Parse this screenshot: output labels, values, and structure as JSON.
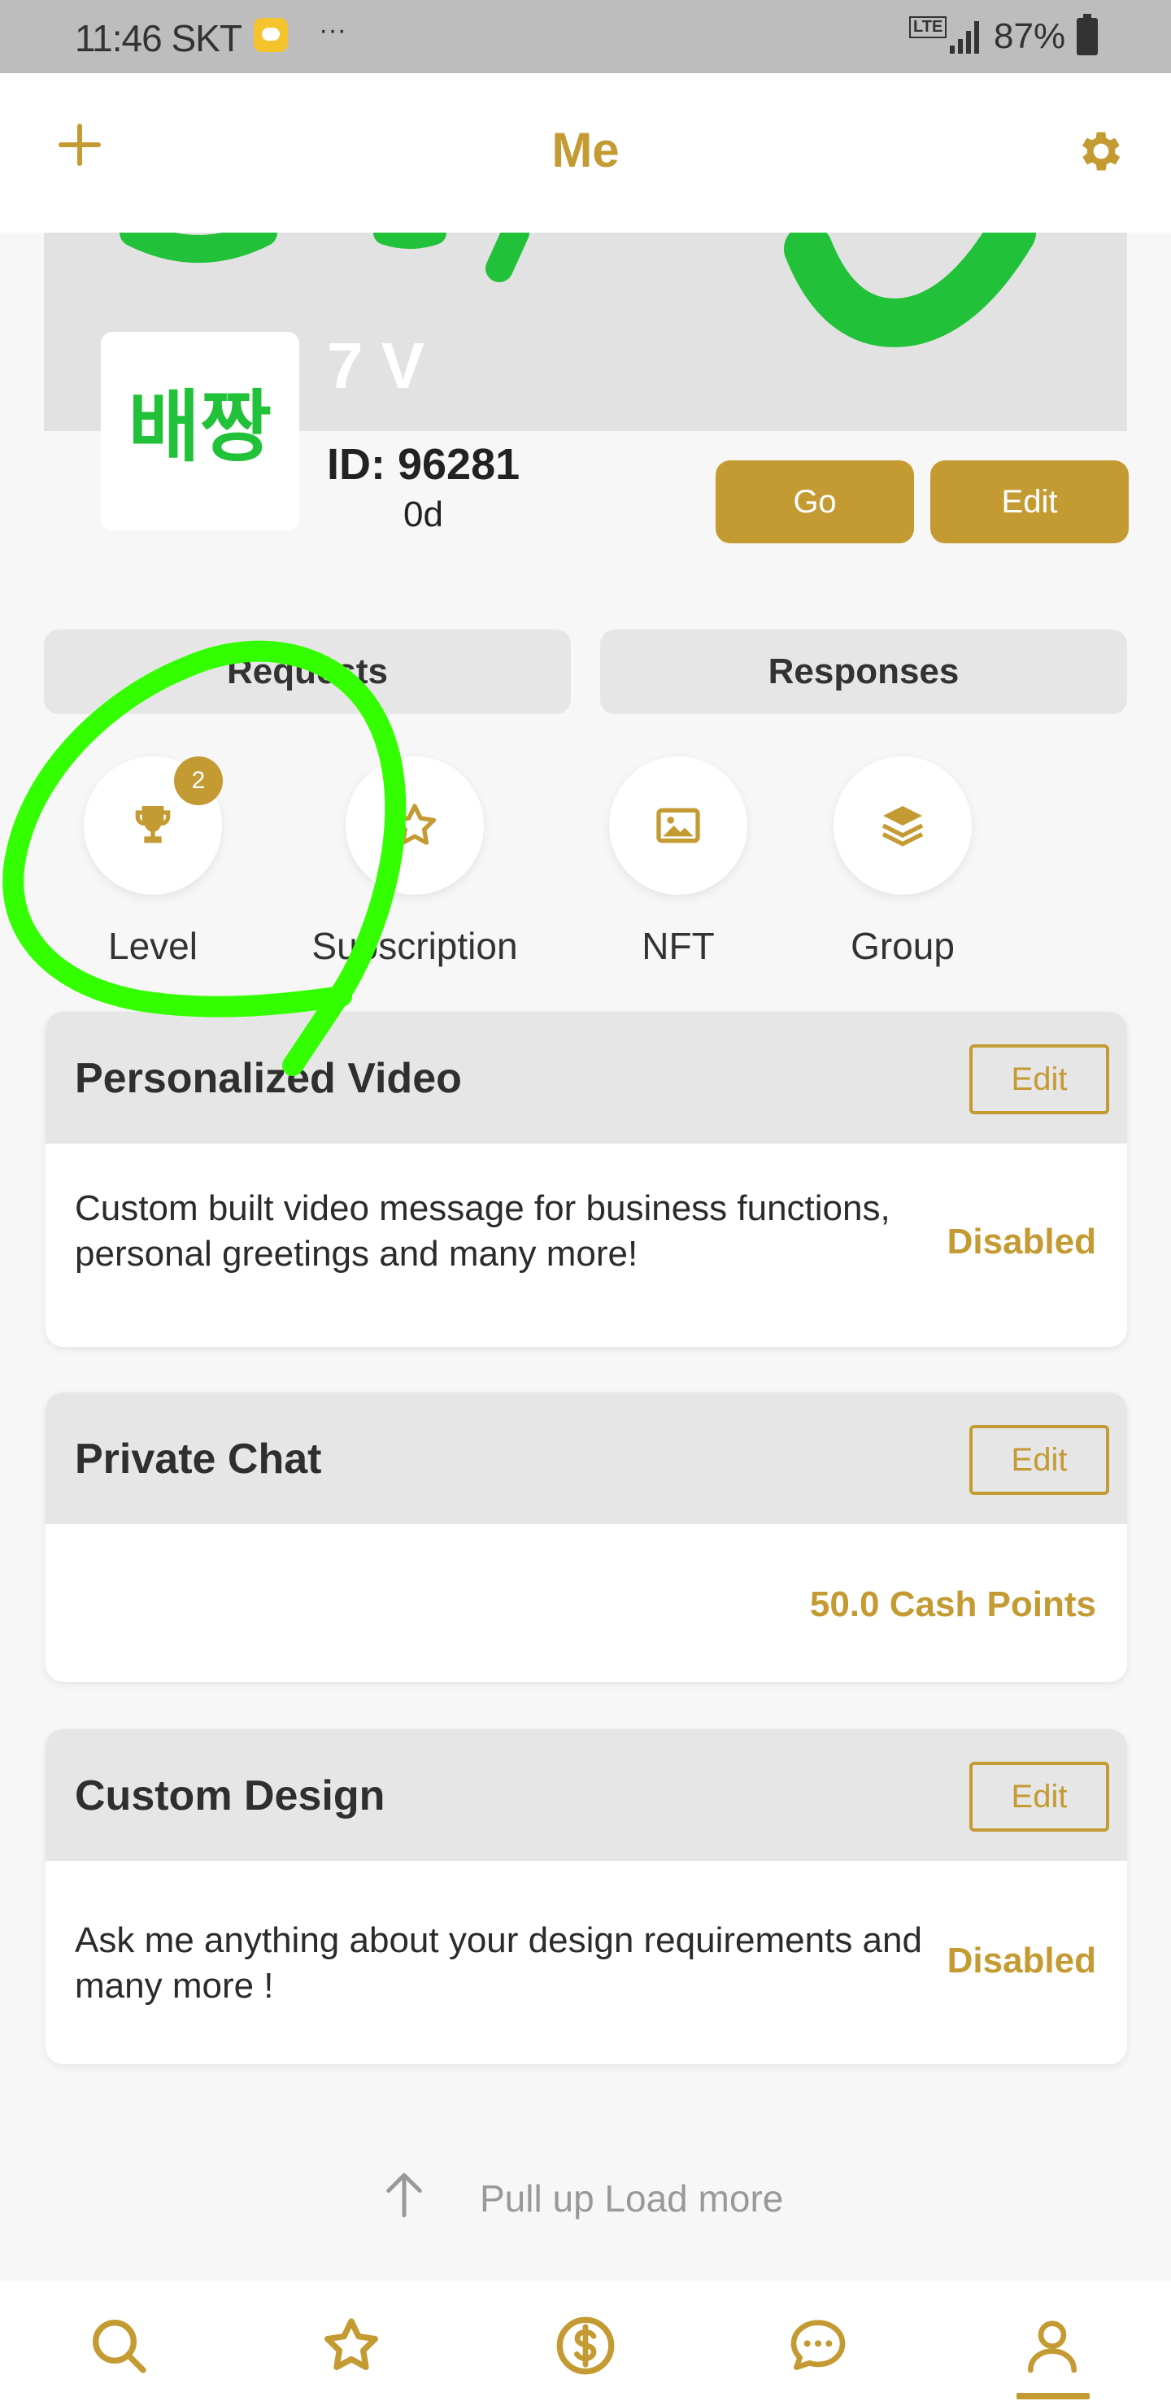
{
  "status_bar": {
    "time": "11:46 SKT",
    "dots": "···",
    "network": "LTE",
    "battery": "87%"
  },
  "header": {
    "title": "Me",
    "add_icon": "plus-icon",
    "settings_icon": "gear-icon"
  },
  "profile": {
    "avatar_text": "배짱",
    "display_name": "7 V",
    "id_label": "ID: 96281",
    "duration": "0d",
    "go_label": "Go",
    "edit_label": "Edit"
  },
  "tabs": [
    {
      "label": "Requests"
    },
    {
      "label": "Responses"
    }
  ],
  "menu": [
    {
      "label": "Level",
      "icon": "trophy-icon",
      "badge": "2"
    },
    {
      "label": "Subscription",
      "icon": "star-icon"
    },
    {
      "label": "NFT",
      "icon": "image-icon"
    },
    {
      "label": "Group",
      "icon": "layers-icon"
    }
  ],
  "services": [
    {
      "title": "Personalized Video",
      "edit_label": "Edit",
      "description": "Custom built video message for business functions, personal greetings and many more!",
      "status": "Disabled"
    },
    {
      "title": "Private Chat",
      "edit_label": "Edit",
      "description": "",
      "status": "50.0 Cash Points"
    },
    {
      "title": "Custom Design",
      "edit_label": "Edit",
      "description": "Ask me anything about your design requirements and many more !",
      "status": "Disabled"
    }
  ],
  "load_more": "Pull up Load more",
  "bottom_nav": [
    {
      "icon": "search-icon"
    },
    {
      "icon": "star-icon"
    },
    {
      "icon": "dollar-icon"
    },
    {
      "icon": "chat-icon"
    },
    {
      "icon": "profile-icon"
    }
  ],
  "colors": {
    "accent": "#c49a33",
    "annotation": "#33ff00",
    "avatar_text": "#22c13a"
  }
}
